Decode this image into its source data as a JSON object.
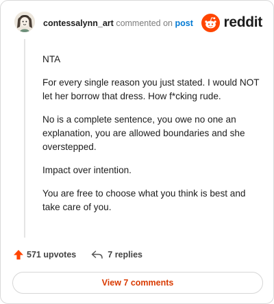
{
  "comment": {
    "username": "contessalynn_art",
    "action": "commented on",
    "post_link": "post",
    "paragraphs": [
      "NTA",
      "For every single reason you just stated. I would NOT let her borrow that dress. How f*cking rude.",
      "No is a complete sentence, you owe no one an explanation, you are allowed boundaries and she overstepped.",
      "Impact over intention.",
      "You are free to choose what you think is best and take care of you."
    ]
  },
  "brand": {
    "wordmark": "reddit",
    "icon": "reddit-snoo-icon",
    "color": "#ff4500"
  },
  "footer": {
    "upvotes": "571 upvotes",
    "replies": "7 replies",
    "upvote_icon": "upvote-arrow-icon",
    "reply_icon": "reply-arrow-icon",
    "upvote_color": "#ff4500"
  },
  "view_button": {
    "label": "View 7 comments",
    "color": "#d93a00"
  }
}
